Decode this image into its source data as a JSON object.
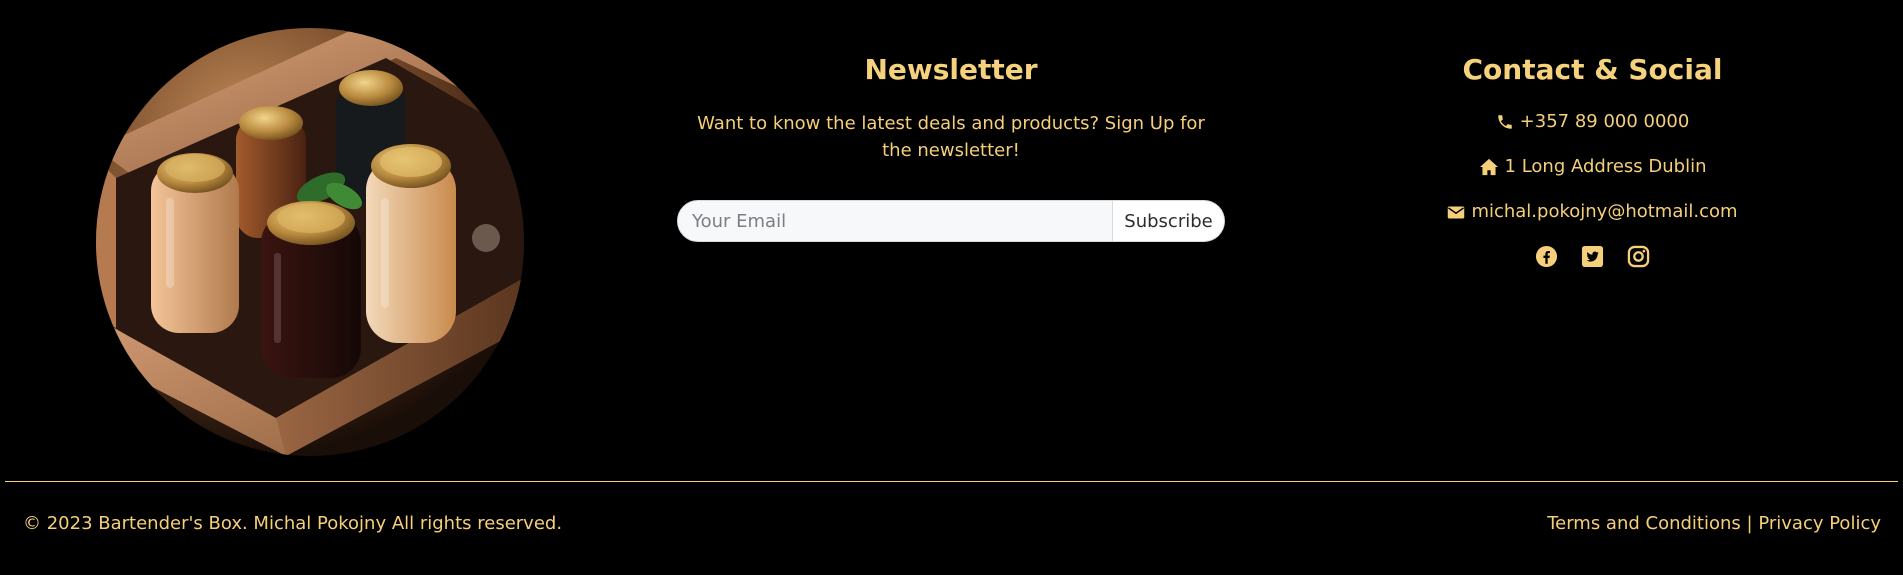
{
  "image": {
    "alt": "Wooden box with jars of drinks"
  },
  "newsletter": {
    "title": "Newsletter",
    "description": "Want to know the latest deals and products? Sign Up for the newsletter!",
    "email_placeholder": "Your Email",
    "subscribe_label": "Subscribe"
  },
  "contact": {
    "title": "Contact & Social",
    "phone": "+357 89 000 0000",
    "address": "1 Long Address Dublin",
    "email": "michal.pokojny@hotmail.com",
    "phone_icon": "phone-icon",
    "address_icon": "home-icon",
    "email_icon": "envelope-icon",
    "social": [
      "facebook-icon",
      "twitter-icon",
      "instagram-icon"
    ]
  },
  "footer": {
    "copyright": "© 2023 Bartender's Box. Michal Pokojny All rights reserved.",
    "terms": "Terms and Conditions",
    "separator": "|",
    "privacy": "Privacy Policy"
  },
  "colors": {
    "background": "#000000",
    "accent": "#f5cf7a",
    "input_background": "#f7f8fa"
  }
}
